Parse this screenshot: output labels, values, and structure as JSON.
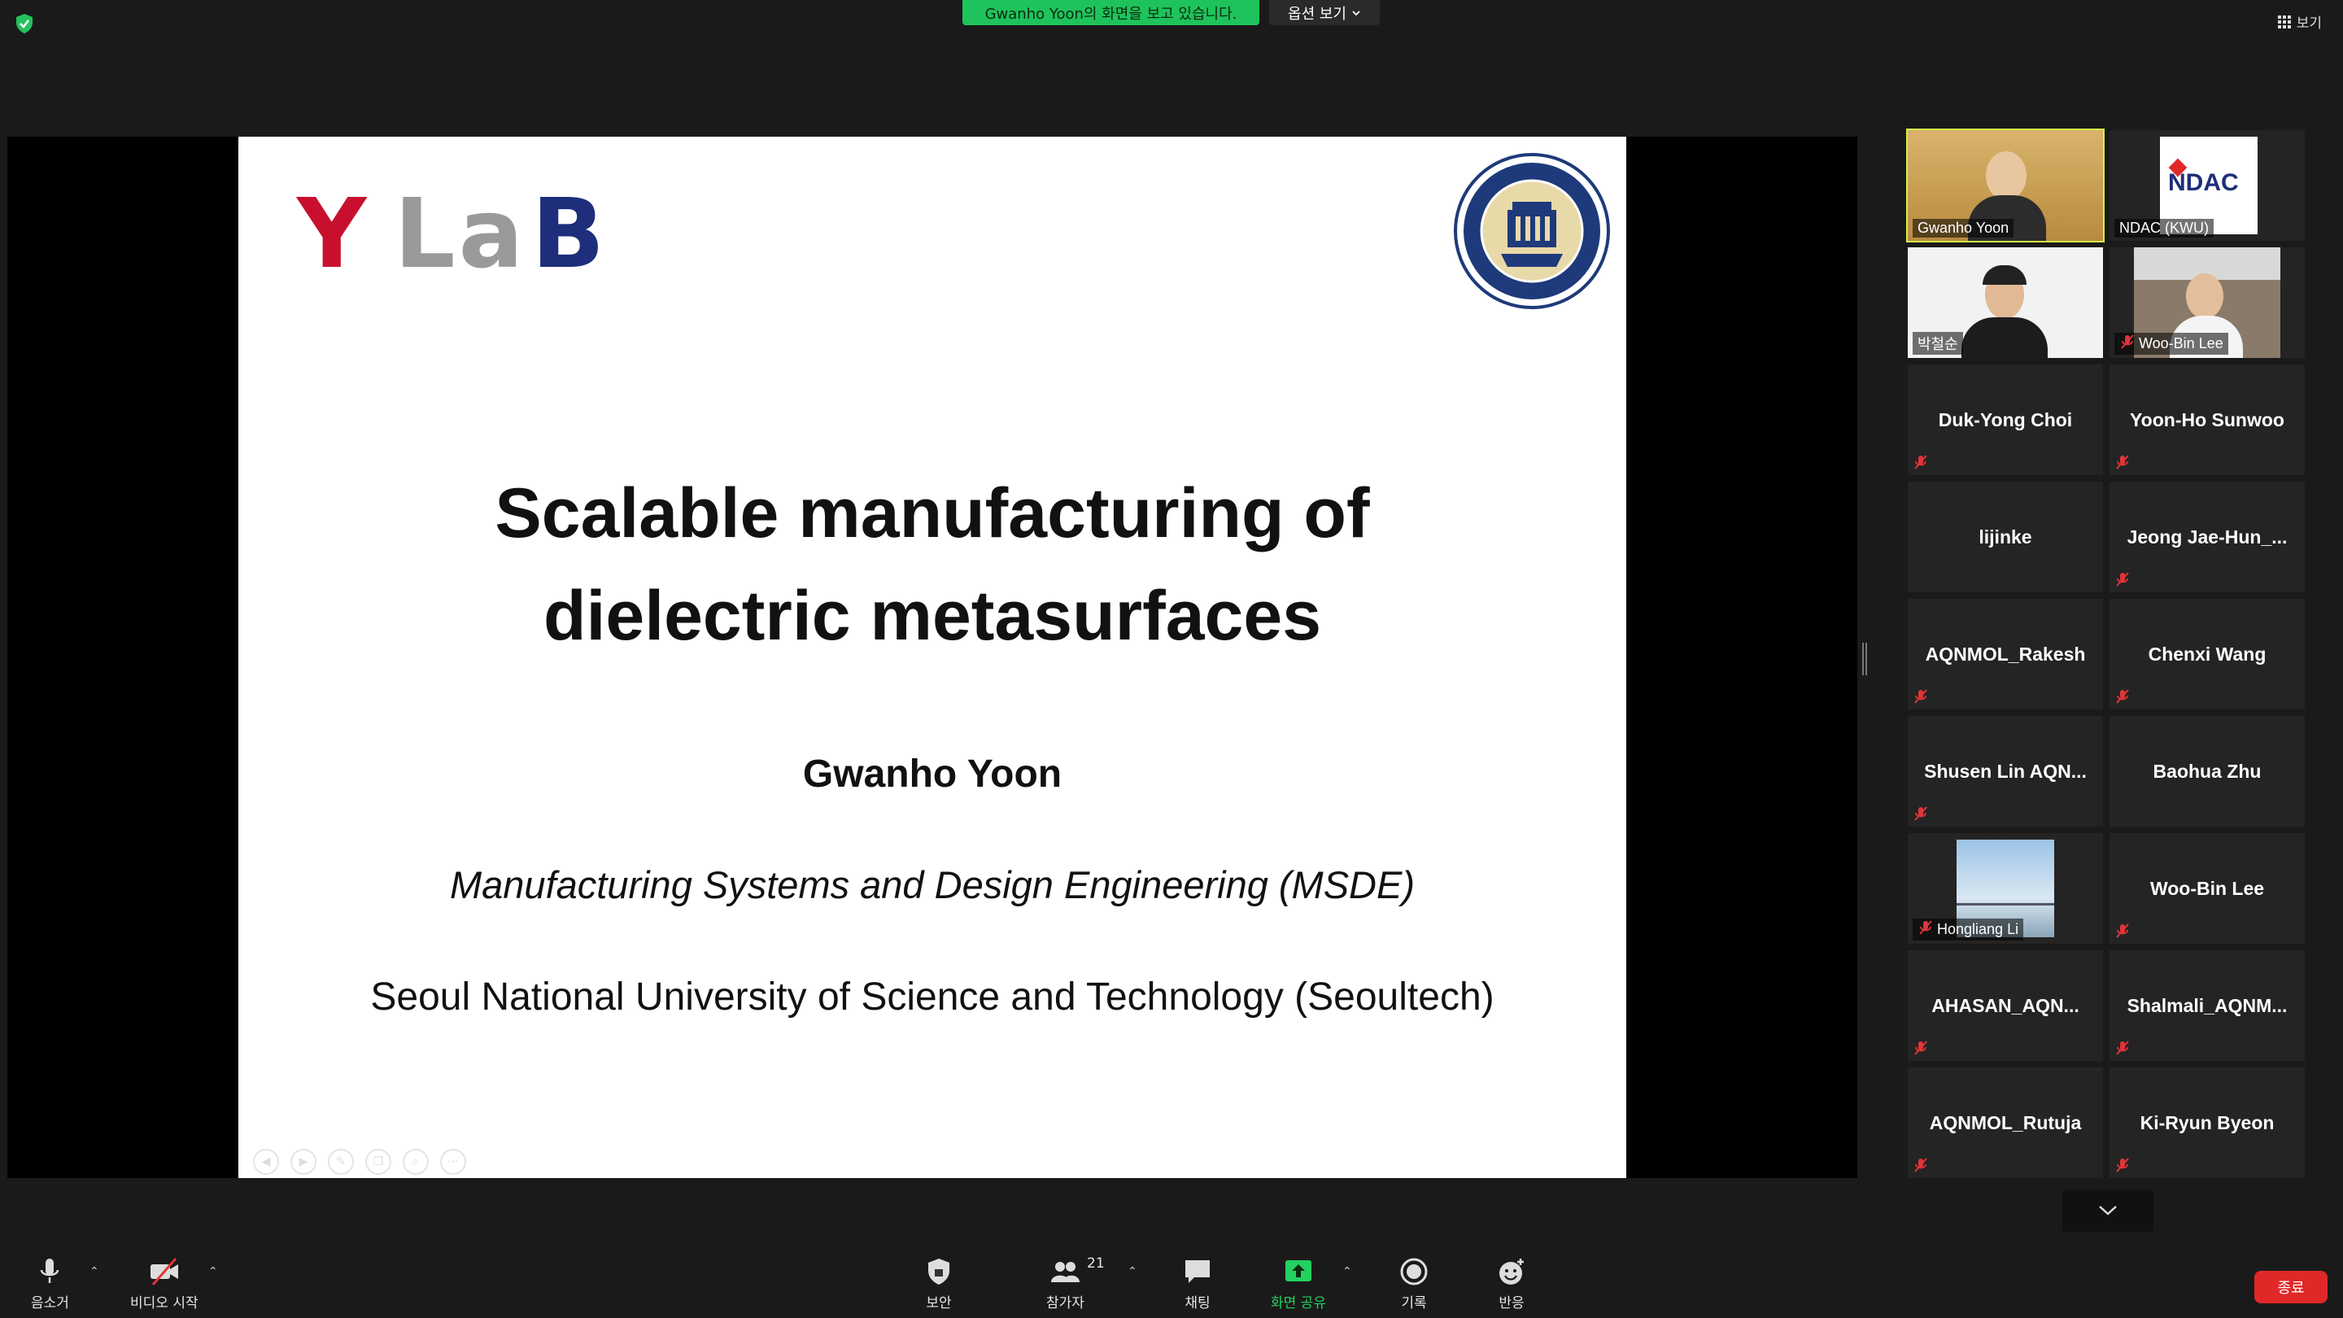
{
  "topbar": {
    "viewing_banner": "Gwanho Yoon의 화면을 보고 있습니다.",
    "view_options": "옵션 보기",
    "gallery_view": "보기"
  },
  "slide": {
    "logo_y": "Y",
    "logo_la": "La",
    "logo_b": "B",
    "title_line1": "Scalable manufacturing of",
    "title_line2": "dielectric metasurfaces",
    "author": "Gwanho Yoon",
    "department": "Manufacturing Systems and Design Engineering (MSDE)",
    "university": "Seoul National University of Science and Technology (Seoultech)"
  },
  "participants": [
    {
      "name": "Gwanho Yoon",
      "video": true,
      "muted": false,
      "active": true
    },
    {
      "name": "NDAC (KWU)",
      "video": true,
      "muted": false,
      "active": false
    },
    {
      "name": "박철순",
      "video": true,
      "muted": false,
      "active": false
    },
    {
      "name": "Woo-Bin Lee",
      "video": true,
      "muted": true,
      "active": false
    },
    {
      "name": "Duk-Yong Choi",
      "video": false,
      "muted": true
    },
    {
      "name": "Yoon-Ho Sunwoo",
      "video": false,
      "muted": true
    },
    {
      "name": "lijinke",
      "video": false,
      "muted": false
    },
    {
      "name": "Jeong  Jae-Hun_...",
      "video": false,
      "muted": true
    },
    {
      "name": "AQNMOL_Rakesh",
      "video": false,
      "muted": true
    },
    {
      "name": "Chenxi Wang",
      "video": false,
      "muted": true
    },
    {
      "name": "Shusen  Lin  AQN...",
      "video": false,
      "muted": true
    },
    {
      "name": "Baohua Zhu",
      "video": false,
      "muted": false
    },
    {
      "name": "Hongliang Li",
      "video": true,
      "muted": true
    },
    {
      "name": "Woo-Bin Lee",
      "video": false,
      "muted": true
    },
    {
      "name": "AHASAN_AQN...",
      "video": false,
      "muted": true
    },
    {
      "name": "Shalmali_AQNM...",
      "video": false,
      "muted": true
    },
    {
      "name": "AQNMOL_Rutuja",
      "video": false,
      "muted": true
    },
    {
      "name": "Ki-Ryun Byeon",
      "video": false,
      "muted": true
    }
  ],
  "ndac_logo": "NDAC",
  "toolbar": {
    "mute": "음소거",
    "video": "비디오 시작",
    "security": "보안",
    "participants": "참가자",
    "participants_count": "21",
    "chat": "채팅",
    "share": "화면 공유",
    "record": "기록",
    "reactions": "반응",
    "end": "종료"
  },
  "colors": {
    "banner": "#1fc35b",
    "active_outline": "#d4f04a",
    "end": "#e02828",
    "share_icon": "#23d160",
    "mute_red": "#e0353a"
  }
}
